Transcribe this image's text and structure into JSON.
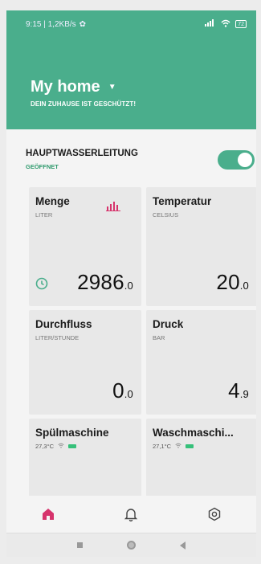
{
  "statusbar": {
    "time_info": "9:15 | 1,2KB/s",
    "battery": "72"
  },
  "header": {
    "home_name": "My home",
    "subtitle": "DEIN ZUHAUSE IST GESCHÜTZT!"
  },
  "mainline": {
    "title": "HAUPTWASSERLEITUNG",
    "status": "GEÖFFNET",
    "toggle_on": true
  },
  "cards": [
    {
      "title": "Menge",
      "unit": "LITER",
      "value": "2986",
      "decimal": ".0"
    },
    {
      "title": "Temperatur",
      "unit": "CELSIUS",
      "value": "20",
      "decimal": ".0"
    },
    {
      "title": "Durchfluss",
      "unit": "LITER/STUNDE",
      "value": "0",
      "decimal": ".0"
    },
    {
      "title": "Druck",
      "unit": "BAR",
      "value": "4",
      "decimal": ".9"
    },
    {
      "title": "Spülmaschine",
      "temp": "27,3°C"
    },
    {
      "title": "Waschmaschi...",
      "temp": "27,1°C"
    }
  ],
  "colors": {
    "accent": "#4aae8c",
    "chart_icon": "#d6336c",
    "home_icon": "#d6336c"
  },
  "icons": {
    "chart": "bar-chart-icon",
    "clock": "clock-icon",
    "home": "home-icon",
    "bell": "bell-icon",
    "settings": "settings-icon"
  }
}
